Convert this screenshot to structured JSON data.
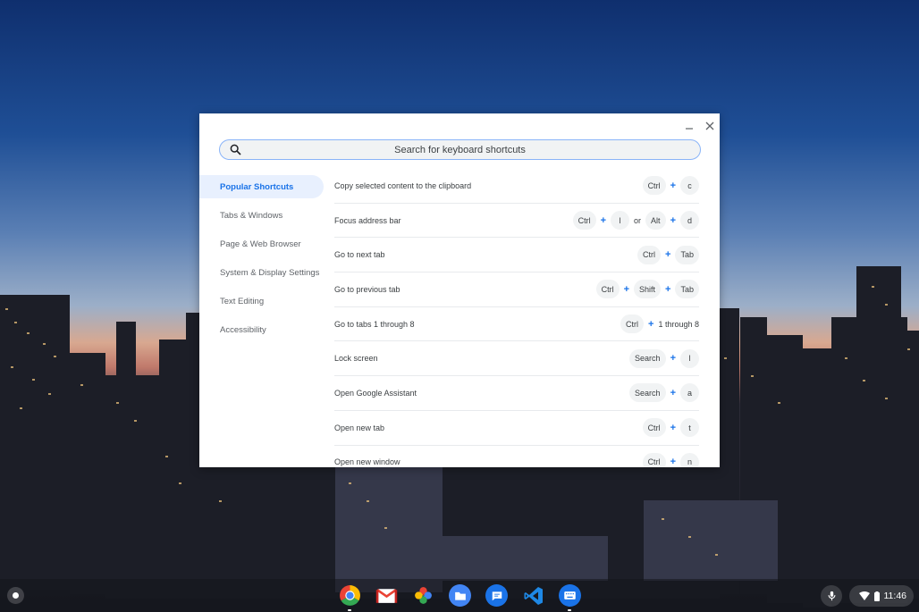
{
  "search": {
    "placeholder": "Search for keyboard shortcuts"
  },
  "window": {
    "minimize_icon": "minimize-icon",
    "close_icon": "close-icon"
  },
  "sidebar": {
    "items": [
      {
        "label": "Popular Shortcuts",
        "active": true
      },
      {
        "label": "Tabs & Windows"
      },
      {
        "label": "Page & Web Browser"
      },
      {
        "label": "System & Display Settings"
      },
      {
        "label": "Text Editing"
      },
      {
        "label": "Accessibility"
      }
    ]
  },
  "shortcuts": [
    {
      "desc": "Copy selected content to the clipboard",
      "k1": "Ctrl",
      "k2": "c"
    },
    {
      "desc": "Focus address bar",
      "k1": "Ctrl",
      "k2": "l",
      "or": "or",
      "k3": "Alt",
      "k4": "d"
    },
    {
      "desc": "Go to next tab",
      "k1": "Ctrl",
      "k2": "Tab"
    },
    {
      "desc": "Go to previous tab",
      "k1": "Ctrl",
      "k2": "Shift",
      "k3": "Tab"
    },
    {
      "desc": "Go to tabs 1 through 8",
      "k1": "Ctrl",
      "text": "1 through 8"
    },
    {
      "desc": "Lock screen",
      "k1": "Search",
      "k2": "l"
    },
    {
      "desc": "Open Google Assistant",
      "k1": "Search",
      "k2": "a"
    },
    {
      "desc": "Open new tab",
      "k1": "Ctrl",
      "k2": "t"
    },
    {
      "desc": "Open new window",
      "k1": "Ctrl",
      "k2": "n"
    }
  ],
  "plus_sign": "+",
  "shelf": {
    "apps": [
      "chrome-icon",
      "gmail-icon",
      "photos-icon",
      "files-icon",
      "messages-icon",
      "vscode-icon",
      "keyboard-shortcuts-icon"
    ],
    "time": "11:46"
  },
  "colors": {
    "accent": "#1a73e8",
    "active_bg": "#e8f0fe",
    "key_bg": "#f1f3f4"
  }
}
